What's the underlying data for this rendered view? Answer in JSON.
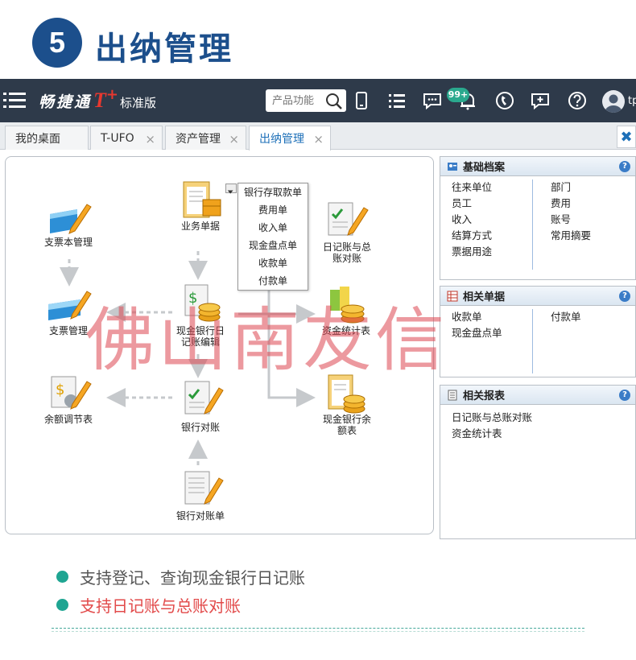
{
  "header": {
    "step": "5",
    "title": "出纳管理"
  },
  "topbar": {
    "brand_name": "畅捷通",
    "brand_t": "T",
    "brand_plus": "+",
    "brand_edition": "标准版",
    "search_placeholder": "产品功能",
    "notification_count": "99+",
    "user_text": "tp"
  },
  "tabs": [
    {
      "label": "我的桌面",
      "closable": false
    },
    {
      "label": "T-UFO",
      "closable": true
    },
    {
      "label": "资产管理",
      "closable": true
    },
    {
      "label": "出纳管理",
      "closable": true,
      "active": true
    }
  ],
  "tab_close_all": "✖",
  "flow": {
    "nodes": {
      "check_book": "支票本管理",
      "check_mgmt": "支票管理",
      "balance_adj": "余额调节表",
      "business_doc": "业务单据",
      "cash_bank_journal_1": "现金银行日",
      "cash_bank_journal_2": "记账编辑",
      "bank_recon": "银行对账",
      "bank_statement": "银行对账单",
      "journal_gl_1": "日记账与总",
      "journal_gl_2": "账对账",
      "fund_stats": "资金统计表",
      "cash_bank_bal_1": "现金银行余",
      "cash_bank_bal_2": "额表"
    },
    "dropdown": [
      "银行存取款单",
      "费用单",
      "收入单",
      "现金盘点单",
      "收款单",
      "付款单"
    ]
  },
  "watermark": "佛山南友信",
  "panels": {
    "basic": {
      "title": "基础档案",
      "left": [
        "往来单位",
        "员工",
        "收入",
        "结算方式",
        "票据用途"
      ],
      "right": [
        "部门",
        "费用",
        "账号",
        "常用摘要"
      ]
    },
    "docs": {
      "title": "相关单据",
      "left": [
        "收款单",
        "现金盘点单"
      ],
      "right": [
        "付款单"
      ]
    },
    "reports": {
      "title": "相关报表",
      "items": [
        "日记账与总账对账",
        "资金统计表"
      ]
    },
    "help_glyph": "?"
  },
  "bullets": [
    {
      "text": "支持登记、查询现金银行日记账"
    },
    {
      "text": "支持日记账与总账对账"
    }
  ],
  "colors": {
    "brand_blue": "#1c4f8c",
    "topbar": "#2e3a4a",
    "accent_green": "#1fa592",
    "highlight_red": "#e24a4a",
    "tab_active_text": "#1c6fb8"
  }
}
